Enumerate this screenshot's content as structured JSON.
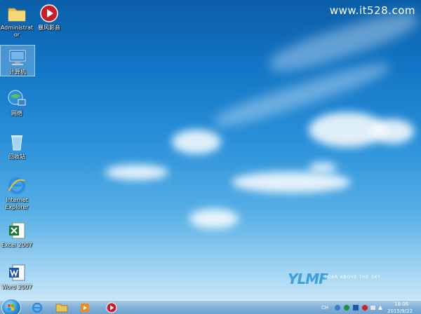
{
  "watermark": "www.it528.com",
  "desktop_icons": [
    {
      "label": "Administrator"
    },
    {
      "label": "暴风影音"
    },
    {
      "label": "计算机"
    },
    {
      "label": "网络"
    },
    {
      "label": "回收站"
    },
    {
      "label": "Internet Explorer"
    },
    {
      "label": "Excel 2007"
    },
    {
      "label": "Word 2007"
    }
  ],
  "logo": {
    "text": "YLMF",
    "tagline": "SOAR ABOVE THE SKY"
  },
  "tray": {
    "lang": "CH",
    "time": "16:06",
    "date": "2015/9/22"
  },
  "colors": {
    "sky_top": "#0b5ea8",
    "sky_bottom": "#d9eef9",
    "taskbar": "#7fb0d9"
  }
}
